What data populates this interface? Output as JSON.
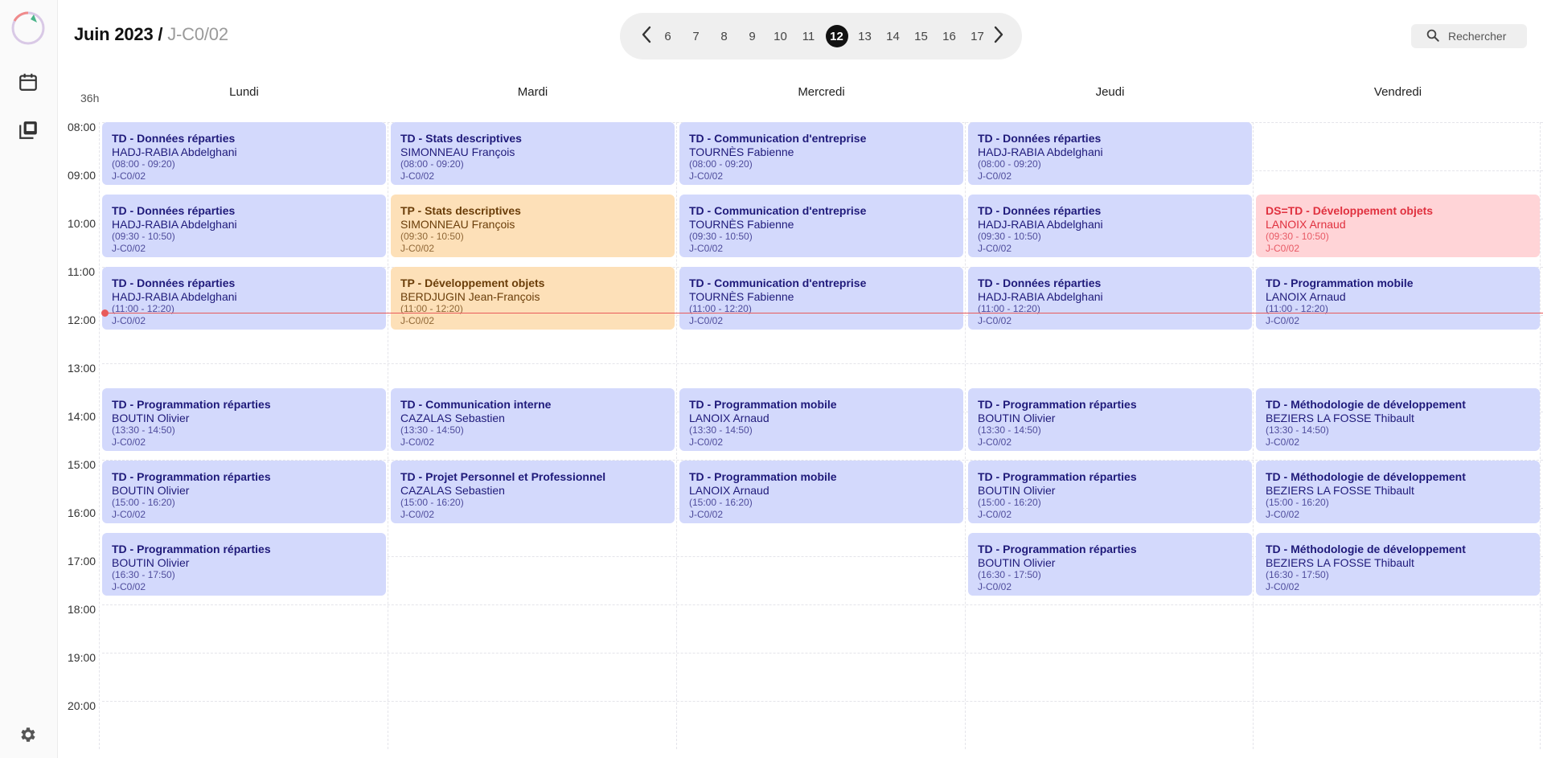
{
  "header": {
    "month": "Juin 2023",
    "separator": "/",
    "room": "J-C0/02",
    "search_label": "Rechercher"
  },
  "weeks": [
    "6",
    "7",
    "8",
    "9",
    "10",
    "11",
    "12",
    "13",
    "14",
    "15",
    "16",
    "17"
  ],
  "active_week": "12",
  "total_hours": "36h",
  "days": [
    "Lundi",
    "Mardi",
    "Mercredi",
    "Jeudi",
    "Vendredi"
  ],
  "hours": [
    "08:00",
    "09:00",
    "10:00",
    "11:00",
    "12:00",
    "13:00",
    "14:00",
    "15:00",
    "16:00",
    "17:00",
    "18:00",
    "19:00",
    "20:00"
  ],
  "events": [
    {
      "day": 0,
      "slot": 0,
      "kind": "td",
      "title": "TD - Données réparties",
      "teacher": "HADJ-RABIA Abdelghani",
      "time": "(08:00 - 09:20)",
      "room": "J-C0/02"
    },
    {
      "day": 0,
      "slot": 1,
      "kind": "td",
      "title": "TD - Données réparties",
      "teacher": "HADJ-RABIA Abdelghani",
      "time": "(09:30 - 10:50)",
      "room": "J-C0/02"
    },
    {
      "day": 0,
      "slot": 2,
      "kind": "td",
      "title": "TD - Données réparties",
      "teacher": "HADJ-RABIA Abdelghani",
      "time": "(11:00 - 12:20)",
      "room": "J-C0/02"
    },
    {
      "day": 0,
      "slot": 3,
      "kind": "td",
      "title": "TD - Programmation réparties",
      "teacher": "BOUTIN Olivier",
      "time": "(13:30 - 14:50)",
      "room": "J-C0/02"
    },
    {
      "day": 0,
      "slot": 4,
      "kind": "td",
      "title": "TD - Programmation réparties",
      "teacher": "BOUTIN Olivier",
      "time": "(15:00 - 16:20)",
      "room": "J-C0/02"
    },
    {
      "day": 0,
      "slot": 5,
      "kind": "td",
      "title": "TD - Programmation réparties",
      "teacher": "BOUTIN Olivier",
      "time": "(16:30 - 17:50)",
      "room": "J-C0/02"
    },
    {
      "day": 1,
      "slot": 0,
      "kind": "td",
      "title": "TD - Stats descriptives",
      "teacher": "SIMONNEAU François",
      "time": "(08:00 - 09:20)",
      "room": "J-C0/02"
    },
    {
      "day": 1,
      "slot": 1,
      "kind": "tp",
      "title": "TP - Stats descriptives",
      "teacher": "SIMONNEAU François",
      "time": "(09:30 - 10:50)",
      "room": "J-C0/02"
    },
    {
      "day": 1,
      "slot": 2,
      "kind": "tp",
      "title": "TP - Développement objets",
      "teacher": "BERDJUGIN Jean-François",
      "time": "(11:00 - 12:20)",
      "room": "J-C0/02"
    },
    {
      "day": 1,
      "slot": 3,
      "kind": "td",
      "title": "TD - Communication interne",
      "teacher": "CAZALAS Sebastien",
      "time": "(13:30 - 14:50)",
      "room": "J-C0/02"
    },
    {
      "day": 1,
      "slot": 4,
      "kind": "td",
      "title": "TD - Projet Personnel et Professionnel",
      "teacher": "CAZALAS Sebastien",
      "time": "(15:00 - 16:20)",
      "room": "J-C0/02"
    },
    {
      "day": 2,
      "slot": 0,
      "kind": "td",
      "title": "TD - Communication d'entreprise",
      "teacher": "TOURNÈS Fabienne",
      "time": "(08:00 - 09:20)",
      "room": "J-C0/02"
    },
    {
      "day": 2,
      "slot": 1,
      "kind": "td",
      "title": "TD - Communication d'entreprise",
      "teacher": "TOURNÈS Fabienne",
      "time": "(09:30 - 10:50)",
      "room": "J-C0/02"
    },
    {
      "day": 2,
      "slot": 2,
      "kind": "td",
      "title": "TD - Communication d'entreprise",
      "teacher": "TOURNÈS Fabienne",
      "time": "(11:00 - 12:20)",
      "room": "J-C0/02"
    },
    {
      "day": 2,
      "slot": 3,
      "kind": "td",
      "title": "TD - Programmation mobile",
      "teacher": "LANOIX Arnaud",
      "time": "(13:30 - 14:50)",
      "room": "J-C0/02"
    },
    {
      "day": 2,
      "slot": 4,
      "kind": "td",
      "title": "TD - Programmation mobile",
      "teacher": "LANOIX Arnaud",
      "time": "(15:00 - 16:20)",
      "room": "J-C0/02"
    },
    {
      "day": 3,
      "slot": 0,
      "kind": "td",
      "title": "TD - Données réparties",
      "teacher": "HADJ-RABIA Abdelghani",
      "time": "(08:00 - 09:20)",
      "room": "J-C0/02"
    },
    {
      "day": 3,
      "slot": 1,
      "kind": "td",
      "title": "TD - Données réparties",
      "teacher": "HADJ-RABIA Abdelghani",
      "time": "(09:30 - 10:50)",
      "room": "J-C0/02"
    },
    {
      "day": 3,
      "slot": 2,
      "kind": "td",
      "title": "TD - Données réparties",
      "teacher": "HADJ-RABIA Abdelghani",
      "time": "(11:00 - 12:20)",
      "room": "J-C0/02"
    },
    {
      "day": 3,
      "slot": 3,
      "kind": "td",
      "title": "TD - Programmation réparties",
      "teacher": "BOUTIN Olivier",
      "time": "(13:30 - 14:50)",
      "room": "J-C0/02"
    },
    {
      "day": 3,
      "slot": 4,
      "kind": "td",
      "title": "TD - Programmation réparties",
      "teacher": "BOUTIN Olivier",
      "time": "(15:00 - 16:20)",
      "room": "J-C0/02"
    },
    {
      "day": 3,
      "slot": 5,
      "kind": "td",
      "title": "TD - Programmation réparties",
      "teacher": "BOUTIN Olivier",
      "time": "(16:30 - 17:50)",
      "room": "J-C0/02"
    },
    {
      "day": 4,
      "slot": 1,
      "kind": "ds",
      "title": "DS=TD - Développement objets",
      "teacher": "LANOIX Arnaud",
      "time": "(09:30 - 10:50)",
      "room": "J-C0/02"
    },
    {
      "day": 4,
      "slot": 2,
      "kind": "td",
      "title": "TD - Programmation mobile",
      "teacher": "LANOIX Arnaud",
      "time": "(11:00 - 12:20)",
      "room": "J-C0/02"
    },
    {
      "day": 4,
      "slot": 3,
      "kind": "td",
      "title": "TD - Méthodologie de développement",
      "teacher": "BEZIERS LA FOSSE Thibault",
      "time": "(13:30 - 14:50)",
      "room": "J-C0/02"
    },
    {
      "day": 4,
      "slot": 4,
      "kind": "td",
      "title": "TD - Méthodologie de développement",
      "teacher": "BEZIERS LA FOSSE Thibault",
      "time": "(15:00 - 16:20)",
      "room": "J-C0/02"
    },
    {
      "day": 4,
      "slot": 5,
      "kind": "td",
      "title": "TD - Méthodologie de développement",
      "teacher": "BEZIERS LA FOSSE Thibault",
      "time": "(16:30 - 17:50)",
      "room": "J-C0/02"
    }
  ],
  "colors": {
    "td_bg": "#d3d9fc",
    "tp_bg": "#fde0b8",
    "ds_bg": "#ffd4d7",
    "now_line": "#e85a5a"
  },
  "icons": {
    "logo": "app-logo-ring",
    "calendar": "calendar-icon",
    "library": "library-icon",
    "settings": "gear-icon",
    "search": "search-icon",
    "prev": "chevron-left-icon",
    "next": "chevron-right-icon"
  }
}
